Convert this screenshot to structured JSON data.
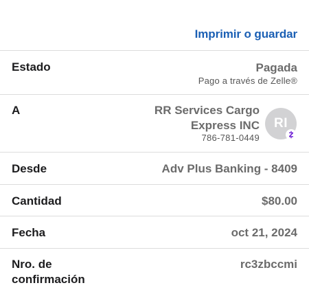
{
  "header": {
    "print_label": "Imprimir o guardar"
  },
  "status": {
    "label": "Estado",
    "value": "Pagada",
    "subtitle": "Pago a través de Zelle®"
  },
  "recipient": {
    "label": "A",
    "name_line1": "RR Services Cargo",
    "name_line2": "Express INC",
    "phone": "786-781-0449",
    "initials": "RI",
    "badge_icon": "zelle-icon"
  },
  "source": {
    "label": "Desde",
    "value": "Adv Plus Banking - 8409"
  },
  "amount": {
    "label": "Cantidad",
    "value": "$80.00"
  },
  "date": {
    "label": "Fecha",
    "value": "oct 21, 2024"
  },
  "confirmation": {
    "label_line1": "Nro. de",
    "label_line2": "confirmación",
    "value": "rc3zbccmi"
  },
  "colors": {
    "link": "#1a5fb4",
    "zelle": "#6d1ed4",
    "avatar_bg": "#d2d2d4"
  }
}
